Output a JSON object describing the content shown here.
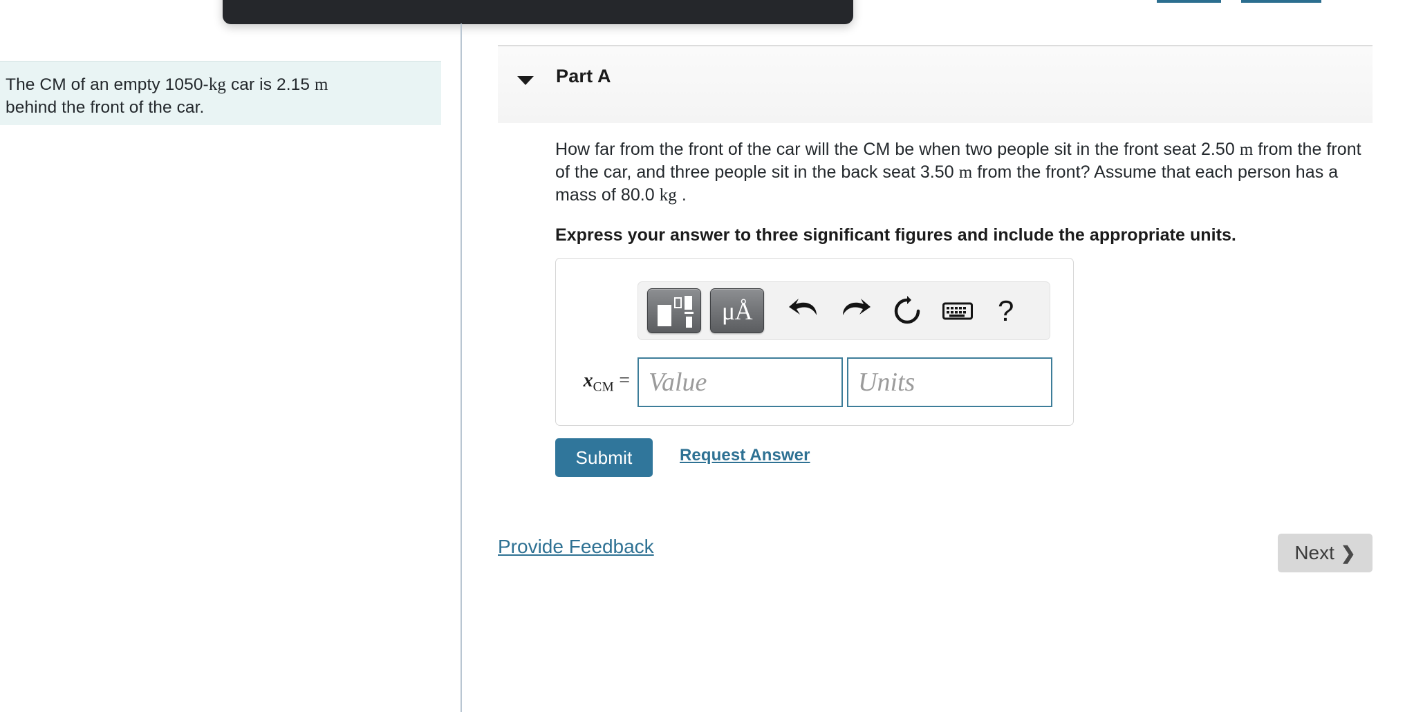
{
  "overlay": {
    "outline_button_label": "",
    "filled_button_label": ""
  },
  "hint": {
    "text_part1": "The CM of an empty 1050-",
    "unit_kg": "kg",
    "text_part2": " car is 2.15 ",
    "unit_m": "m",
    "text_part3": "behind the front of the car."
  },
  "part": {
    "title": "Part A",
    "caret_icon": "caret-down-icon"
  },
  "question": {
    "line_a": "How far from the front of the car will the CM be when two people sit in the front seat 2.50 ",
    "unit_m_1": "m",
    "line_b": " from the front of the car, and three people sit in the back seat 3.50 ",
    "unit_m_2": "m",
    "line_c": " from the front? Assume that each person has a mass of 80.0 ",
    "unit_kg": "kg",
    "line_d": " .",
    "instruction": "Express your answer to three significant figures and include the appropriate units."
  },
  "toolbar": {
    "template_button": "template-icon",
    "units_button": "μÅ",
    "undo_icon": "undo-icon",
    "redo_icon": "redo-icon",
    "reset_icon": "reset-icon",
    "keyboard_icon": "keyboard-icon",
    "help_icon": "?"
  },
  "answer": {
    "variable_x": "x",
    "variable_sub": "CM",
    "equals": "=",
    "value_placeholder": "Value",
    "value_text": "",
    "units_placeholder": "Units",
    "units_text": ""
  },
  "actions": {
    "submit_label": "Submit",
    "request_answer_label": "Request Answer"
  },
  "footer": {
    "feedback_label": "Provide Feedback",
    "next_label": "Next",
    "next_chevron": "❯"
  },
  "colors": {
    "accent_teal": "#2e7193",
    "submit_blue": "#30769b",
    "hint_bg": "#e9f4f4",
    "input_border": "#3d7d99",
    "next_bg": "#d8d8d8",
    "dark_panel": "#25272b",
    "overlay_filled": "#8cadf0"
  }
}
